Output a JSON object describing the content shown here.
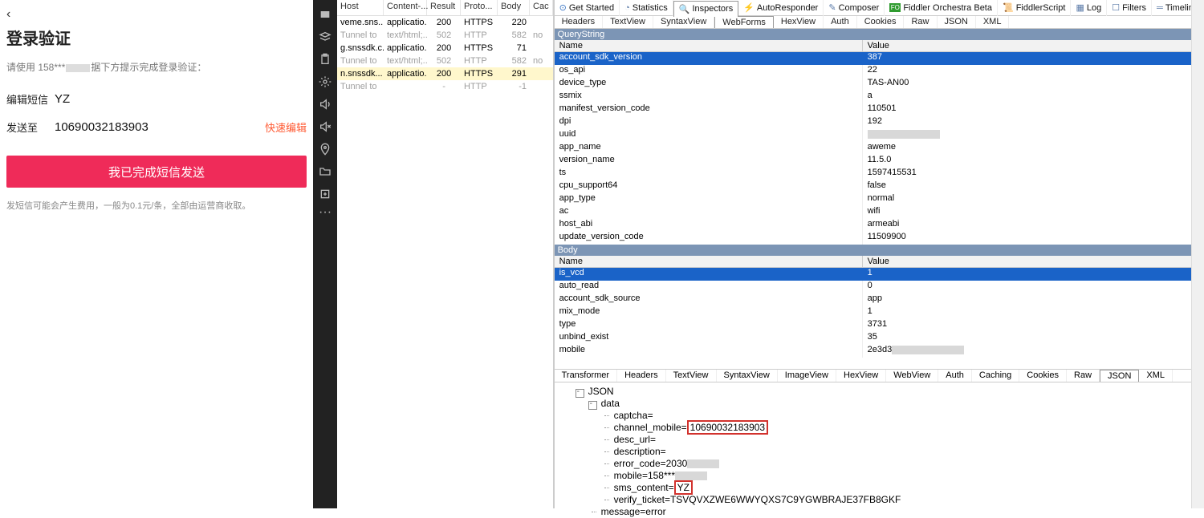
{
  "left": {
    "title": "登录验证",
    "hint_prefix": "请使用 158***",
    "hint_suffix": "据下方提示完成登录验证：",
    "edit_label": "编辑短信",
    "edit_value": "YZ",
    "send_label": "发送至",
    "send_value": "10690032183903",
    "quick_edit": "快速编辑",
    "button": "我已完成短信发送",
    "footnote": "发短信可能会产生费用，一般为0.1元/条，全部由运营商收取。"
  },
  "sessions": {
    "headers": [
      "Host",
      "Content-...",
      "Result",
      "Proto...",
      "Body",
      "Cac"
    ],
    "rows": [
      {
        "host": "veme.sns...",
        "ct": "applicatio...",
        "res": "200",
        "prot": "HTTPS",
        "body": "220",
        "tunnel": false,
        "sel": false
      },
      {
        "host": "Tunnel to",
        "ct": "text/html;...",
        "res": "502",
        "prot": "HTTP",
        "body": "582",
        "cac": "no",
        "tunnel": true,
        "sel": false
      },
      {
        "host": "g.snssdk.c...",
        "ct": "applicatio...",
        "res": "200",
        "prot": "HTTPS",
        "body": "71",
        "tunnel": false,
        "sel": false
      },
      {
        "host": "Tunnel to",
        "ct": "text/html;...",
        "res": "502",
        "prot": "HTTP",
        "body": "582",
        "cac": "no",
        "tunnel": true,
        "sel": false
      },
      {
        "host": "n.snssdk...",
        "ct": "applicatio...",
        "res": "200",
        "prot": "HTTPS",
        "body": "291",
        "tunnel": false,
        "sel": true
      },
      {
        "host": "Tunnel to",
        "ct": "",
        "res": "-",
        "prot": "HTTP",
        "body": "-1",
        "tunnel": true,
        "sel": false
      }
    ]
  },
  "top_tabs": [
    "Get Started",
    "Statistics",
    "Inspectors",
    "AutoResponder",
    "Composer",
    "Fiddler Orchestra Beta",
    "FiddlerScript",
    "Log",
    "Filters",
    "Timeline"
  ],
  "sub_tabs": [
    "Headers",
    "TextView",
    "SyntaxView",
    "WebForms",
    "HexView",
    "Auth",
    "Cookies",
    "Raw",
    "JSON",
    "XML"
  ],
  "qs_title": "QueryString",
  "kv_headers": {
    "name": "Name",
    "value": "Value"
  },
  "qs_rows": [
    {
      "n": "account_sdk_version",
      "v": "387",
      "sel": true
    },
    {
      "n": "os_api",
      "v": "22"
    },
    {
      "n": "device_type",
      "v": "TAS-AN00"
    },
    {
      "n": "ssmix",
      "v": "a"
    },
    {
      "n": "manifest_version_code",
      "v": "110501"
    },
    {
      "n": "dpi",
      "v": "192"
    },
    {
      "n": "uuid",
      "v": "",
      "blur": true
    },
    {
      "n": "app_name",
      "v": "aweme"
    },
    {
      "n": "version_name",
      "v": "11.5.0"
    },
    {
      "n": "ts",
      "v": "1597415531"
    },
    {
      "n": "cpu_support64",
      "v": "false"
    },
    {
      "n": "app_type",
      "v": "normal"
    },
    {
      "n": "ac",
      "v": "wifi"
    },
    {
      "n": "host_abi",
      "v": "armeabi"
    },
    {
      "n": "update_version_code",
      "v": "11509900"
    }
  ],
  "body_title": "Body",
  "body_rows": [
    {
      "n": "is_vcd",
      "v": "1",
      "sel": true
    },
    {
      "n": "auto_read",
      "v": "0"
    },
    {
      "n": "account_sdk_source",
      "v": "app"
    },
    {
      "n": "mix_mode",
      "v": "1"
    },
    {
      "n": "type",
      "v": "3731"
    },
    {
      "n": "unbind_exist",
      "v": "35"
    },
    {
      "n": "mobile",
      "v": "2e3d3",
      "blur": true
    }
  ],
  "resp_tabs": [
    "Transformer",
    "Headers",
    "TextView",
    "SyntaxView",
    "ImageView",
    "HexView",
    "WebView",
    "Auth",
    "Caching",
    "Cookies",
    "Raw",
    "JSON",
    "XML"
  ],
  "json_tree": {
    "root": "JSON",
    "data_label": "data",
    "leaves": [
      {
        "k": "captcha",
        "v": ""
      },
      {
        "k": "channel_mobile",
        "v": "10690032183903",
        "hl": true
      },
      {
        "k": "desc_url",
        "v": ""
      },
      {
        "k": "description",
        "v": ""
      },
      {
        "k": "error_code",
        "v": "2030",
        "blur": true
      },
      {
        "k": "mobile",
        "v": "158***",
        "blur": true
      },
      {
        "k": "sms_content",
        "v": "YZ",
        "hl": true
      },
      {
        "k": "verify_ticket",
        "v": "TSVQVXZWE6WWYQXS7C9YGWBRAJE37FB8GKF"
      }
    ],
    "tail": "message=error"
  }
}
